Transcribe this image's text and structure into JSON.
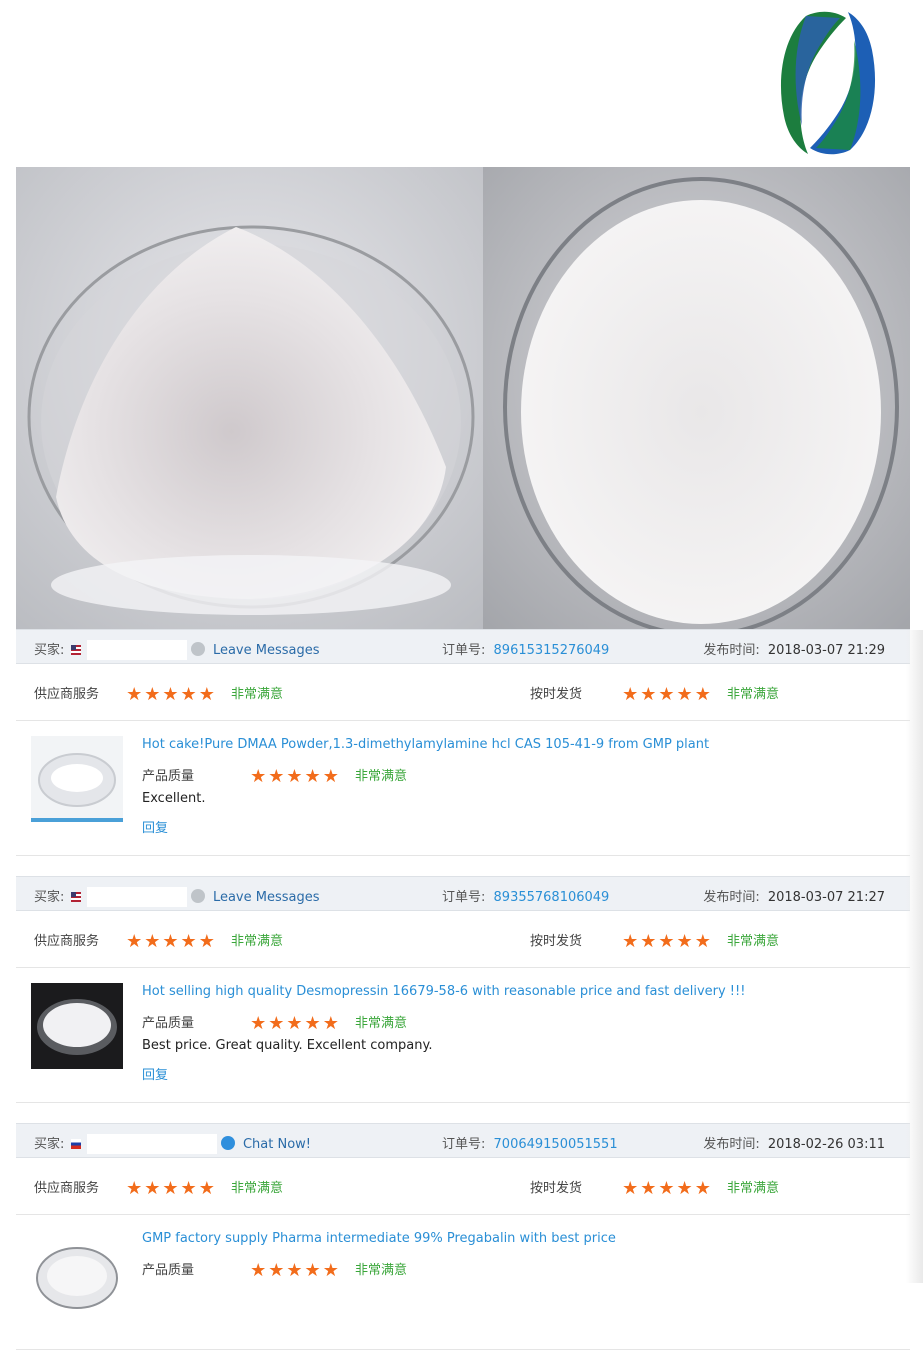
{
  "brand": {
    "logo_icon": "company-logo-icon",
    "colors": [
      "#1a7a3a",
      "#1c5fb0"
    ]
  },
  "reviews": [
    {
      "buyer_label": "买家:",
      "buyer_flag": "us-flag-icon",
      "contact_link": "Leave Messages",
      "order_label": "订单号:",
      "order_number": "89615315276049",
      "time_label": "发布时间:",
      "time_value": "2018-03-07 21:29",
      "supplier_service_label": "供应商服务",
      "supplier_service_text": "非常满意",
      "supplier_service_stars": 5,
      "ontime_label": "按时发货",
      "ontime_text": "非常满意",
      "ontime_stars": 5,
      "product_title": "Hot cake!Pure DMAA Powder,1.3-dimethylamylamine hcl CAS 105-41-9 from GMP plant",
      "quality_label": "产品质量",
      "quality_text": "非常满意",
      "quality_stars": 5,
      "comment": "Excellent.",
      "reply": "回复"
    },
    {
      "buyer_label": "买家:",
      "buyer_flag": "us-flag-icon",
      "contact_link": "Leave Messages",
      "order_label": "订单号:",
      "order_number": "89355768106049",
      "time_label": "发布时间:",
      "time_value": "2018-03-07 21:27",
      "supplier_service_label": "供应商服务",
      "supplier_service_text": "非常满意",
      "supplier_service_stars": 5,
      "ontime_label": "按时发货",
      "ontime_text": "非常满意",
      "ontime_stars": 5,
      "product_title": "Hot selling high quality Desmopressin 16679-58-6 with reasonable price and fast delivery !!!",
      "quality_label": "产品质量",
      "quality_text": "非常满意",
      "quality_stars": 5,
      "comment": "Best price. Great quality. Excellent company.",
      "reply": "回复"
    },
    {
      "buyer_label": "买家:",
      "buyer_flag": "ru-flag-icon",
      "contact_link": "Chat Now!",
      "order_label": "订单号:",
      "order_number": "700649150051551",
      "time_label": "发布时间:",
      "time_value": "2018-02-26 03:11",
      "supplier_service_label": "供应商服务",
      "supplier_service_text": "非常满意",
      "supplier_service_stars": 5,
      "ontime_label": "按时发货",
      "ontime_text": "非常满意",
      "ontime_stars": 5,
      "product_title": "GMP factory supply Pharma intermediate 99% Pregabalin with best price",
      "quality_label": "产品质量",
      "quality_text": "非常满意",
      "quality_stars": 5
    }
  ],
  "star_glyphs": "★★★★★"
}
